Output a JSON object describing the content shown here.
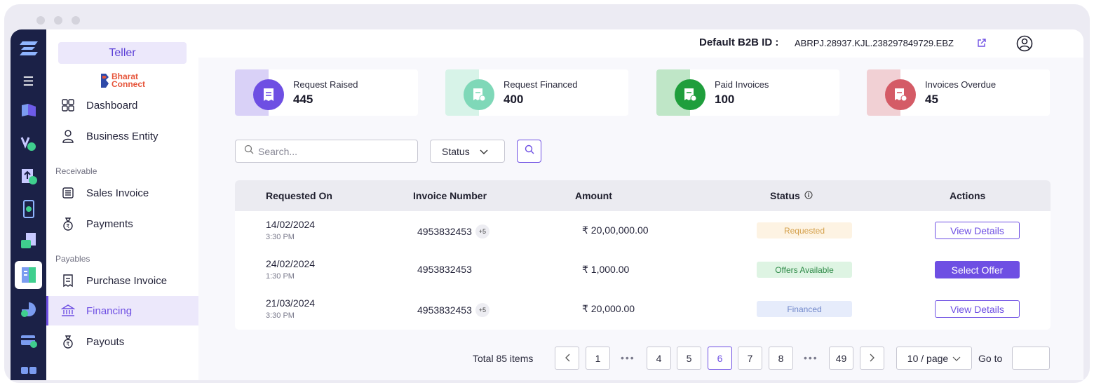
{
  "sidebar": {
    "teller_label": "Teller",
    "brand_top": "Bharat",
    "brand_bottom": "Connect",
    "items": [
      {
        "label": "Dashboard"
      },
      {
        "label": "Business Entity"
      },
      {
        "label": "Sales Invoice"
      },
      {
        "label": "Payments"
      },
      {
        "label": "Purchase Invoice"
      },
      {
        "label": "Financing"
      },
      {
        "label": "Payouts"
      }
    ],
    "sections": {
      "receivable": "Receivable",
      "payables": "Payables"
    },
    "active_item": "Financing"
  },
  "header": {
    "b2b_label": "Default B2B ID :",
    "b2b_value": "ABRPJ.28937.KJL.238297849729.EBZ"
  },
  "stats": [
    {
      "label": "Request Raised",
      "value": "445",
      "color": "#6e4fe3",
      "strip": "#d9d1f7"
    },
    {
      "label": "Request Financed",
      "value": "400",
      "color": "#7fd8b8",
      "strip": "#d7f3e8"
    },
    {
      "label": "Paid Invoices",
      "value": "100",
      "color": "#1f9e3c",
      "strip": "#bfe6c7"
    },
    {
      "label": "Invoices Overdue",
      "value": "45",
      "color": "#d45b66",
      "strip": "#f1d0d4"
    }
  ],
  "filters": {
    "search_placeholder": "Search...",
    "status_label": "Status"
  },
  "table": {
    "headers": [
      "Requested On",
      "Invoice Number",
      "Amount",
      "Status",
      "Actions"
    ],
    "rows": [
      {
        "date": "14/02/2024",
        "time": "3:30 PM",
        "invoice": "4953832453",
        "more": "+5",
        "amount": "₹ 20,00,000.00",
        "status": "Requested",
        "action": "View Details"
      },
      {
        "date": "24/02/2024",
        "time": "1:30 PM",
        "invoice": "4953832453",
        "more": "",
        "amount": "₹ 1,000.00",
        "status": "Offers Available",
        "action": "Select Offer"
      },
      {
        "date": "21/03/2024",
        "time": "3:30 PM",
        "invoice": "4953832453",
        "more": "+5",
        "amount": "₹ 20,000.00",
        "status": "Financed",
        "action": "View Details"
      }
    ],
    "status_colors": {
      "Requested": {
        "bg": "#fdf3e3",
        "fg": "#d4a04b"
      },
      "Offers Available": {
        "bg": "#def4e3",
        "fg": "#2e8a47"
      },
      "Financed": {
        "bg": "#e6ecfb",
        "fg": "#6f86c9"
      }
    }
  },
  "pagination": {
    "total": "Total 85 items",
    "pages": [
      "1",
      "4",
      "5",
      "6",
      "7",
      "8",
      "49"
    ],
    "current": "6",
    "ellipsis": "•••",
    "per_page": "10 / page",
    "goto_label": "Go to"
  }
}
